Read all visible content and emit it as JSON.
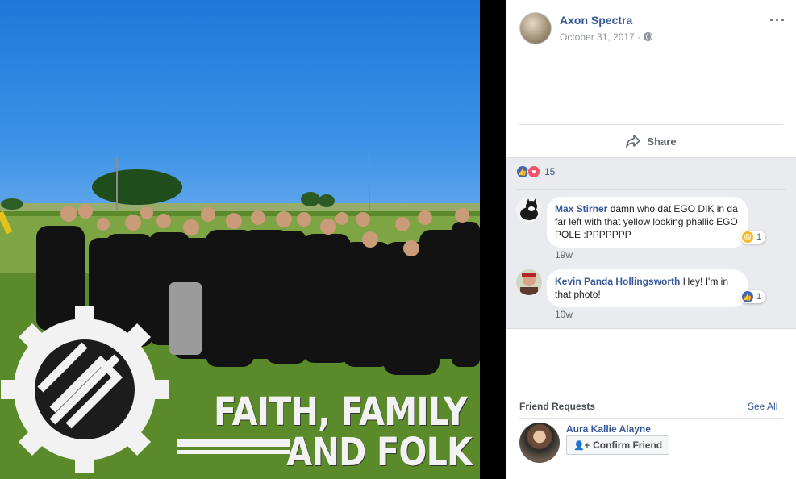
{
  "post": {
    "author": "Axon Spectra",
    "date": "October 31, 2017 ·",
    "more_icon": "···",
    "share_label": "Share",
    "reaction_count": "15",
    "image": {
      "caption_line1": "FAITH, FAMILY",
      "caption_line2": "AND FOLK"
    }
  },
  "comments": [
    {
      "name": "Max Stirner",
      "text": "damn who dat EGO DIK in da far left with that yellow looking phallic EGO POLE :PPPPPPP",
      "time": "19w",
      "reaction_icon": "haha",
      "reaction_count": "1"
    },
    {
      "name": "Kevin Panda Hollingsworth",
      "text": "Hey! I'm in that photo!",
      "time": "10w",
      "reaction_icon": "like",
      "reaction_count": "1"
    }
  ],
  "friend_requests": {
    "title": "Friend Requests",
    "see_all": "See All",
    "requester": "Aura Kallie Alayne",
    "confirm_label": "Confirm Friend"
  },
  "colors": {
    "link": "#365899",
    "like": "#4267b2",
    "love": "#f25268",
    "panel_bg": "#e9ebee"
  }
}
